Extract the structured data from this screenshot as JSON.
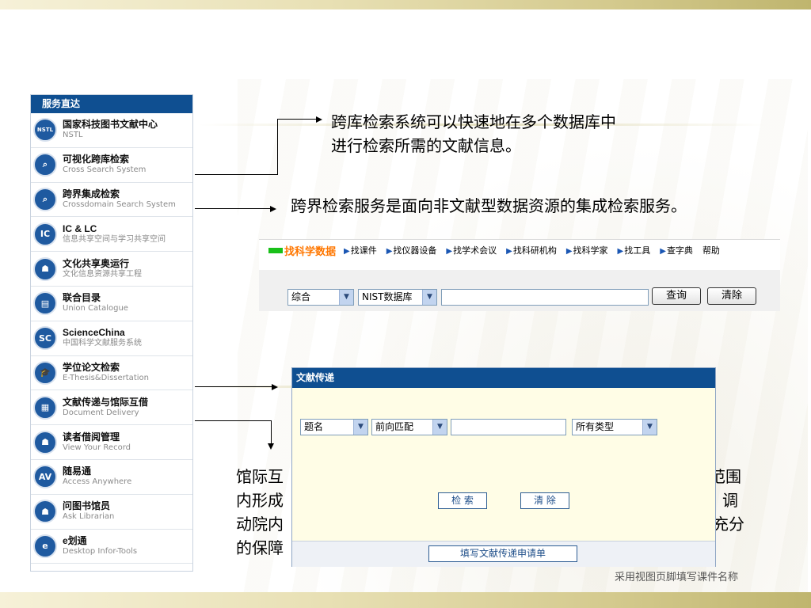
{
  "panel": {
    "header": "服务直达",
    "items": [
      {
        "icon": "NSTL",
        "icon_name": "nstl-logo-icon",
        "title": "国家科技图书文献中心",
        "subtitle": "NSTL"
      },
      {
        "icon": "⌕",
        "icon_name": "magnifier-icon",
        "title": "可视化跨库检索",
        "subtitle": "Cross Search System"
      },
      {
        "icon": "⌕",
        "icon_name": "magnifier-icon",
        "title": "跨界集成检索",
        "subtitle": "Crossdomain Search System"
      },
      {
        "icon": "IC",
        "icon_name": "ic-logo-icon",
        "title": "IC & LC",
        "subtitle": "信息共享空间与学习共享空间"
      },
      {
        "icon": "☗",
        "icon_name": "person-icon",
        "title": "文化共享奥运行",
        "subtitle": "文化信息资源共享工程"
      },
      {
        "icon": "▤",
        "icon_name": "catalogue-icon",
        "title": "联合目录",
        "subtitle": "Union Catalogue"
      },
      {
        "icon": "SC",
        "icon_name": "sciencechina-logo-icon",
        "title": "ScienceChina",
        "subtitle": "中国科学文献服务系统"
      },
      {
        "icon": "🎓",
        "icon_name": "graduation-cap-icon",
        "title": "学位论文检索",
        "subtitle": "E-Thesis&Dissertation"
      },
      {
        "icon": "▦",
        "icon_name": "document-icon",
        "title": "文献传递与馆际互借",
        "subtitle": "Document Delivery"
      },
      {
        "icon": "☗",
        "icon_name": "person-icon",
        "title": "读者借阅管理",
        "subtitle": "View Your Record"
      },
      {
        "icon": "AV",
        "icon_name": "access-anywhere-icon",
        "title": "随易通",
        "subtitle": "Access Anywhere"
      },
      {
        "icon": "☗",
        "icon_name": "person-icon",
        "title": "问图书馆员",
        "subtitle": "Ask Librarian"
      },
      {
        "icon": "e",
        "icon_name": "desktop-tools-icon",
        "title": "e划通",
        "subtitle": "Desktop Infor-Tools"
      }
    ]
  },
  "captions": {
    "cross_search_line1": "跨库检索系统可以快速地在多个数据库中",
    "cross_search_line2": "进行检索所需的文献信息。",
    "crossdomain": "跨界检索服务是面向非文献型数据资源的集成检索服务。",
    "ill_left_1": "馆际互",
    "ill_left_2": "内形成",
    "ill_left_3": "动院内",
    "ill_left_4": "的保障",
    "ill_right_1": "范围",
    "ill_right_2": "调",
    "ill_right_3": "充分"
  },
  "search": {
    "active_tab": "找科学数据",
    "tabs": [
      "找课件",
      "找仪器设备",
      "找学术会议",
      "找科研机构",
      "找科学家",
      "找工具",
      "查字典"
    ],
    "help": "帮助",
    "type_select": "综合",
    "db_select": "NIST数据库",
    "query_value": "",
    "search_button": "查询",
    "clear_button": "清除"
  },
  "delivery": {
    "title": "文献传递",
    "field_select": "题名",
    "match_select": "前向匹配",
    "query_value": "",
    "type_select": "所有类型",
    "search_button": "检 索",
    "clear_button": "清 除",
    "apply_button": "填写文献传递申请单"
  },
  "footer": "采用视图页脚填写课件名称"
}
